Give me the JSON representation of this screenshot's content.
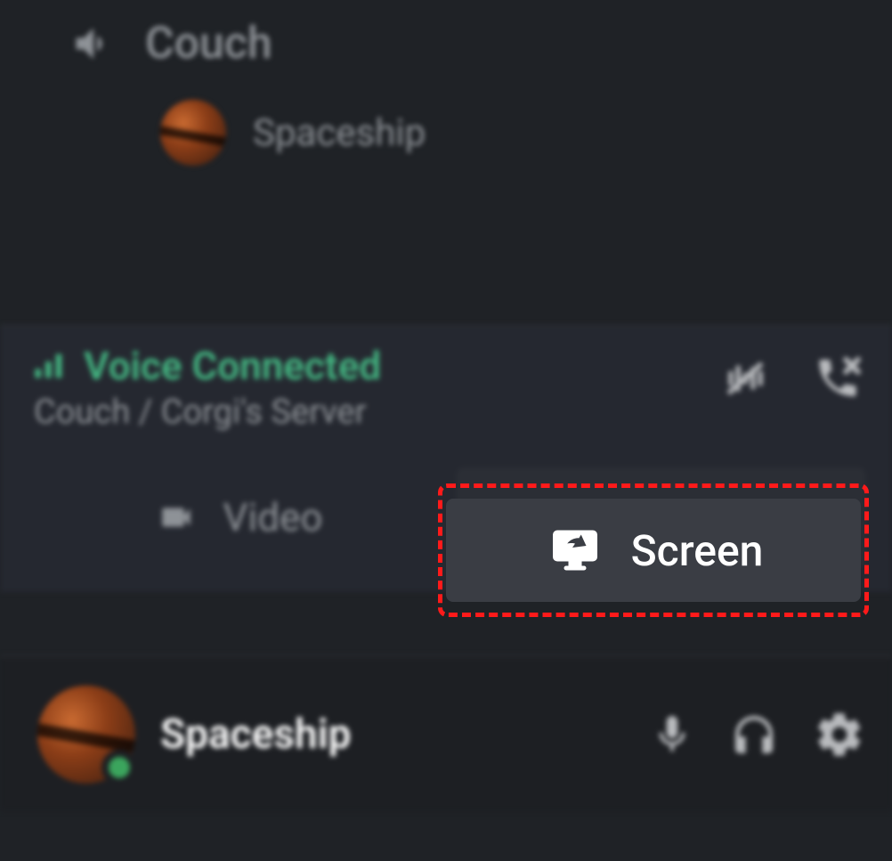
{
  "channel": {
    "name": "Couch"
  },
  "member": {
    "name": "Spaceship"
  },
  "voice": {
    "status": "Voice Connected",
    "subtitle": "Couch / Corgi's Server",
    "video_label": "Video",
    "screen_label": "Screen"
  },
  "user": {
    "name": "Spaceship"
  },
  "icons": {
    "speaker": "speaker-icon",
    "signal": "signal-icon",
    "noise": "noise-suppression-icon",
    "hangup": "disconnect-icon",
    "camera": "camera-icon",
    "screen": "screen-share-icon",
    "mic": "microphone-icon",
    "headphones": "headphones-icon",
    "gear": "settings-icon"
  },
  "colors": {
    "accent": "#43b581",
    "highlight": "#ff1a1a"
  }
}
